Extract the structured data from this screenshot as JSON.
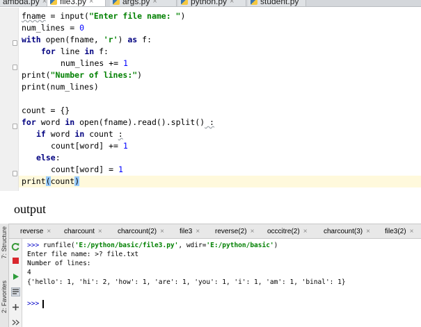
{
  "editor_tabs": [
    {
      "label": "ambda.py",
      "close": "×"
    },
    {
      "label": "file3.py",
      "close": "×",
      "active": true
    },
    {
      "label": "args.py",
      "close": "×"
    },
    {
      "label": "python.py",
      "close": "×"
    },
    {
      "label": "student.py",
      "close": ""
    }
  ],
  "code": {
    "l1": [
      "fname",
      " = input(",
      "\"Enter file name: \"",
      ")"
    ],
    "l2": [
      "num_lines = ",
      "0"
    ],
    "l3": [
      "with",
      " open(fname, ",
      "'r'",
      ") ",
      "as",
      " f:"
    ],
    "l4": [
      "for",
      " line ",
      "in",
      " f:"
    ],
    "l5": [
      "num_lines += ",
      "1"
    ],
    "l6": [
      "print(",
      "\"Number of lines:\"",
      ")"
    ],
    "l7": "print(num_lines)",
    "l8": "count = {}",
    "l9": [
      "for",
      " word ",
      "in",
      " open(fname).read().split()",
      " :"
    ],
    "l10": [
      "if",
      " word ",
      "in",
      " count ",
      ":"
    ],
    "l11": [
      "count[word] += ",
      "1"
    ],
    "l12": [
      "else",
      ":"
    ],
    "l13": [
      "count[word] = ",
      "1"
    ],
    "l14": [
      "print",
      "(",
      "count",
      ")"
    ]
  },
  "output_label": "output",
  "side_labels": {
    "structure": "7: Structure",
    "favorites": "2: Favorites"
  },
  "run_tabs": [
    {
      "label": "reverse",
      "close": "×"
    },
    {
      "label": "charcount",
      "close": "×"
    },
    {
      "label": "charcount(2)",
      "close": "×"
    },
    {
      "label": "file3",
      "close": "×"
    },
    {
      "label": "reverse(2)",
      "close": "×"
    },
    {
      "label": "occcitre(2)",
      "close": "×"
    },
    {
      "label": "charcount(3)",
      "close": "×"
    },
    {
      "label": "file3(2)",
      "close": "×"
    }
  ],
  "console": {
    "run_prompt": ">>> ",
    "run_call": "runfile(",
    "run_file": "'E:/python/basic/file3.py'",
    "run_mid": ", wdir=",
    "run_dir": "'E:/python/basic'",
    "run_end": ")",
    "line2": "Enter file name: >? file.txt",
    "line3": "Number of lines:",
    "line4": "4",
    "line5": "{'hello': 1, 'hi': 2, 'how': 1, 'are': 1, 'you': 1, 'i': 1, 'am': 1, 'binal': 1}",
    "final_prompt": ">>>"
  },
  "colors": {
    "keyword": "#000080",
    "string": "#008000",
    "number": "#0000ff",
    "rerun": "#3a9a3a",
    "stop": "#d9272e",
    "run": "#2e9c3c",
    "current_line": "#fff9dc"
  }
}
